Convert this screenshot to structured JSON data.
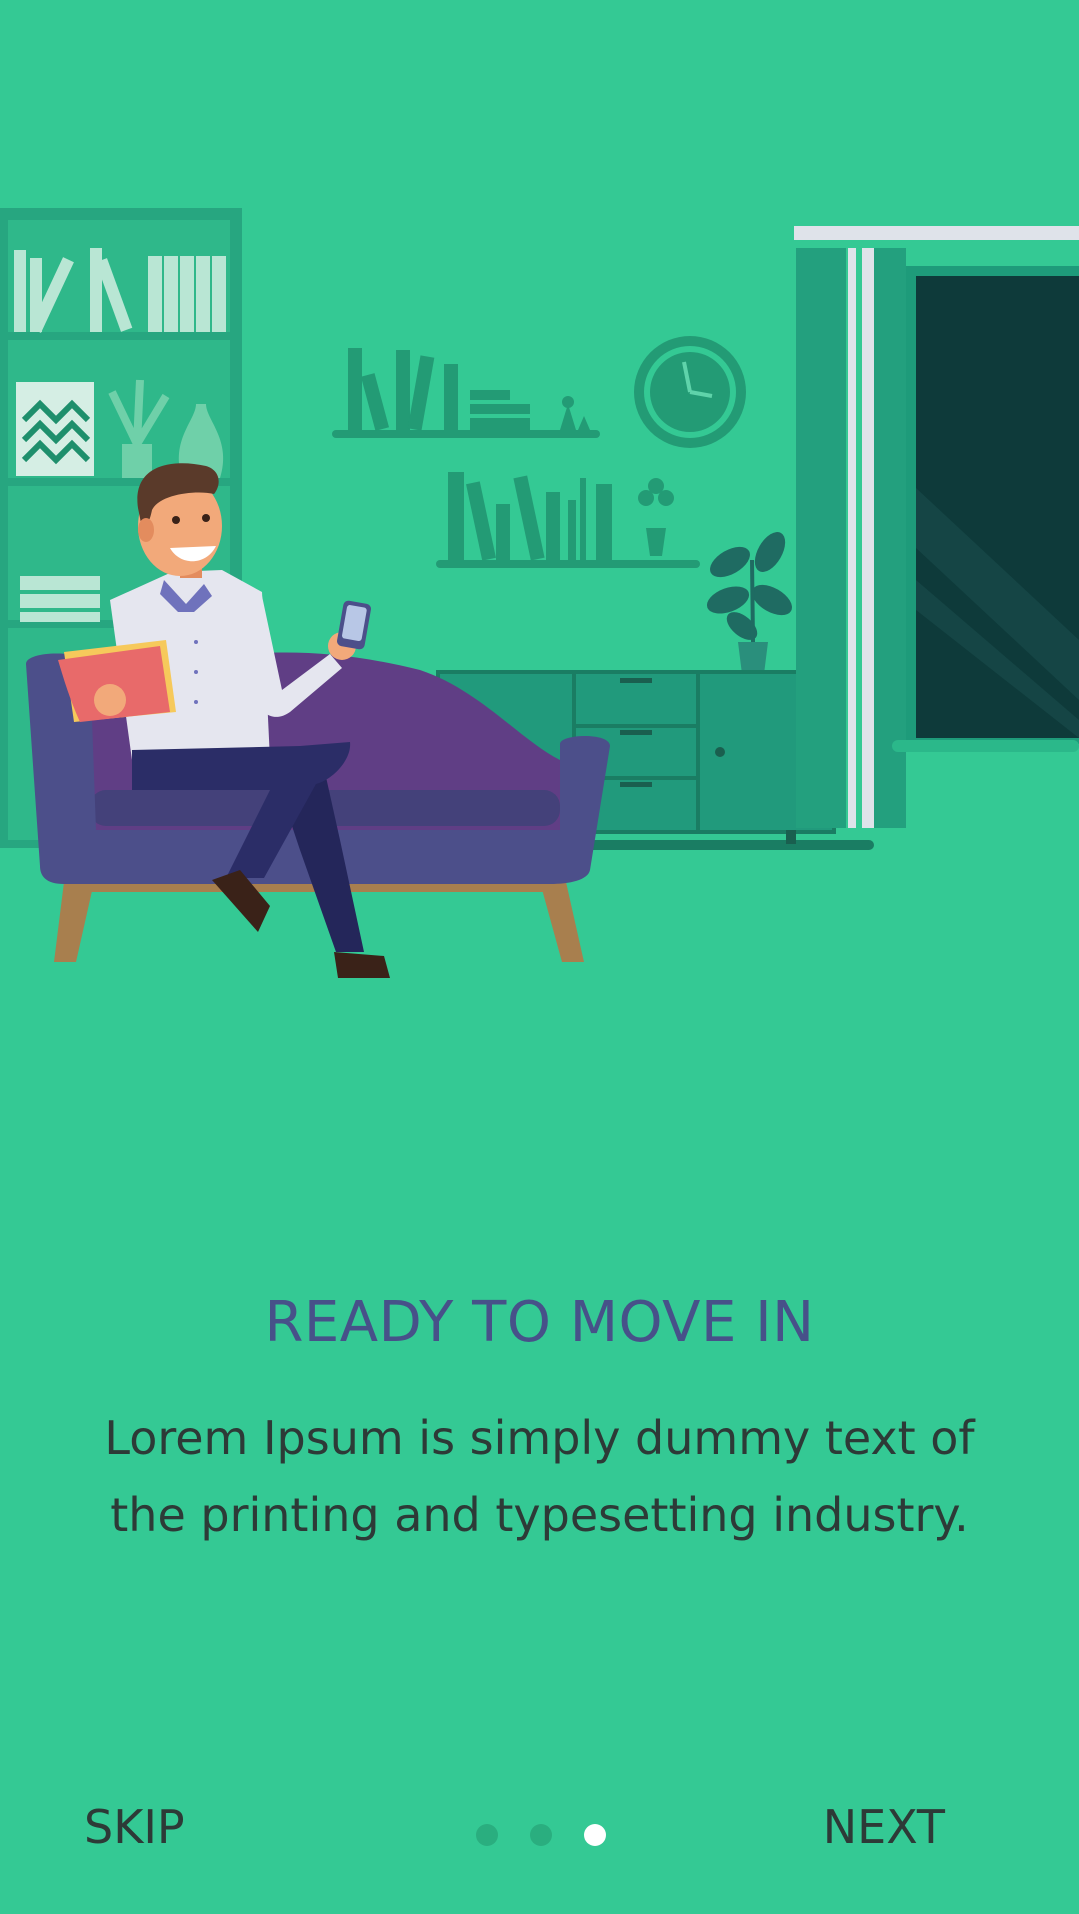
{
  "screen": {
    "title": "READY TO MOVE IN",
    "subtitle": "Lorem Ipsum is simply dummy text of the printing and typesetting industry."
  },
  "actions": {
    "skip_label": "SKIP",
    "next_label": "NEXT"
  },
  "pager": {
    "total": 3,
    "current": 3
  },
  "colors": {
    "background": "#34c994",
    "title": "#475189",
    "text": "#2d3a37",
    "dot_inactive": "#2aae7f",
    "dot_active": "#ffffff"
  }
}
